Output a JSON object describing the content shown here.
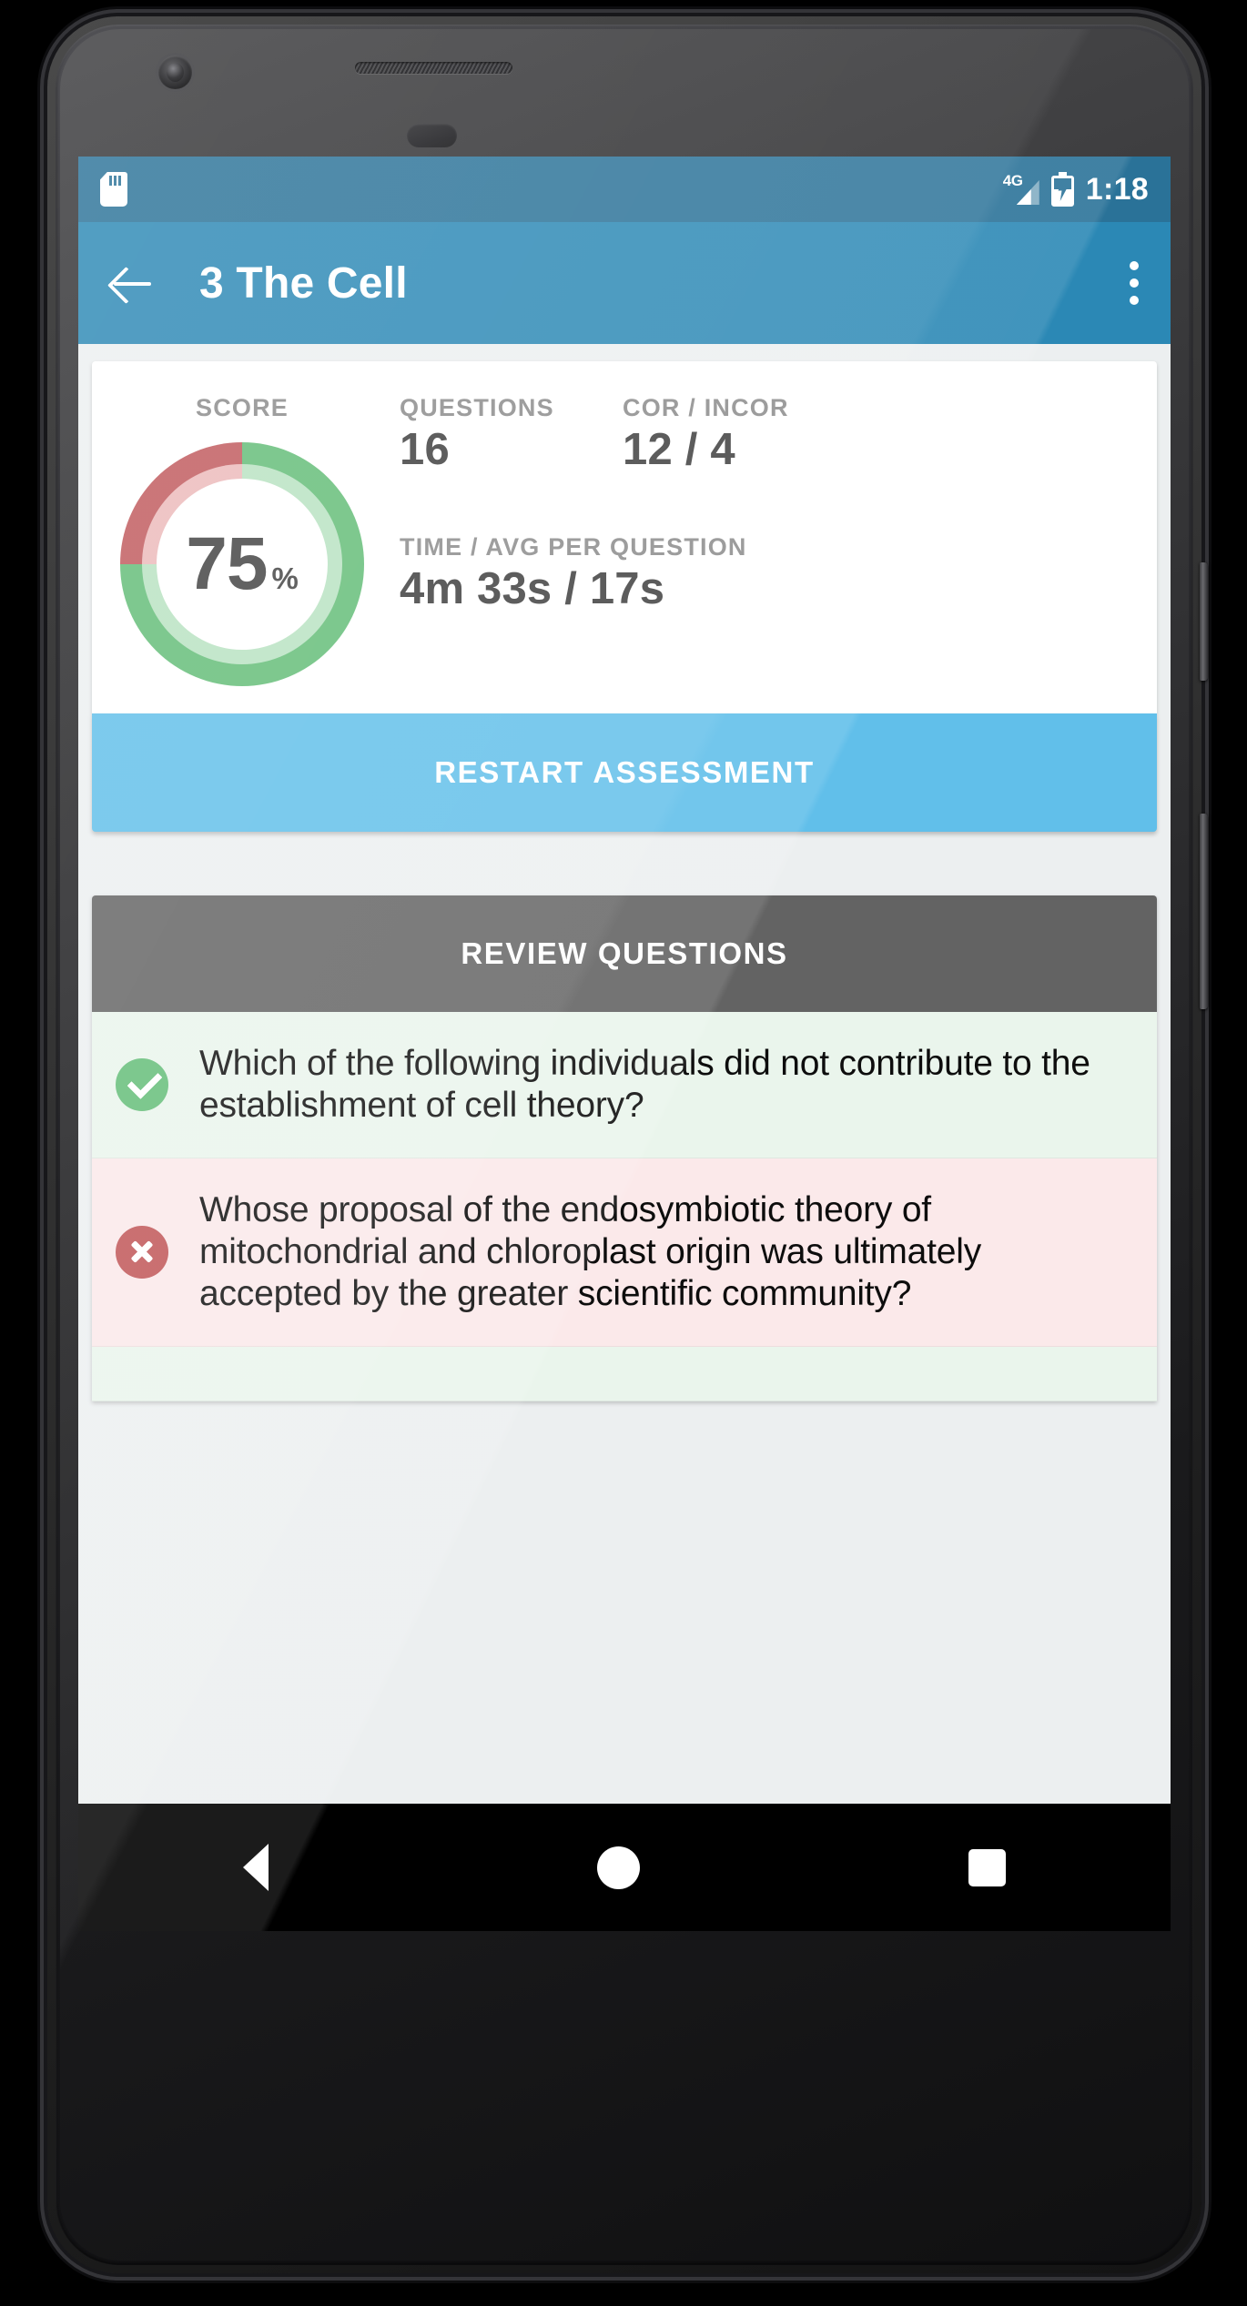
{
  "status_bar": {
    "sd_card_icon": "sd-card-icon",
    "network_label": "4G",
    "signal_icon": "signal-bars-icon",
    "battery_icon": "battery-charging-icon",
    "clock": "1:18"
  },
  "app_bar": {
    "back_icon": "back-arrow-icon",
    "title": "3 The Cell",
    "overflow_icon": "overflow-menu-icon"
  },
  "score_card": {
    "score_label": "SCORE",
    "score_value": "75",
    "score_percent_sign": "%",
    "questions_label": "QUESTIONS",
    "questions_value": "16",
    "cor_incor_label": "COR / INCOR",
    "cor_incor_value": "12 / 4",
    "time_label": "TIME / AVG PER QUESTION",
    "time_value": "4m 33s / 17s"
  },
  "chart_data": {
    "type": "pie",
    "title": "SCORE",
    "categories": [
      "Correct",
      "Incorrect"
    ],
    "values": [
      75,
      25
    ],
    "colors": [
      "#63bd77",
      "#c0595c"
    ],
    "inner_colors": [
      "#b8e2c1",
      "#ecb9ba"
    ],
    "center_label": "75%",
    "start_angle_deg": 0,
    "donut": true
  },
  "buttons": {
    "restart_assessment": "RESTART ASSESSMENT",
    "review_questions": "REVIEW QUESTIONS"
  },
  "questions": [
    {
      "status": "correct",
      "status_icon": "check-circle-icon",
      "text": "Which of the following individuals did not contribute to the establishment of cell theory?"
    },
    {
      "status": "incorrect",
      "status_icon": "x-circle-icon",
      "text": "Whose proposal of the endosymbiotic theory of mitochondrial and chloroplast origin was ultimately accepted by the greater scientific community?"
    },
    {
      "status": "correct",
      "status_icon": "check-circle-icon",
      "text": ""
    }
  ],
  "nav_bar": {
    "back": "nav-back-button",
    "home": "nav-home-button",
    "recents": "nav-recents-button"
  },
  "colors": {
    "status_bar": "#2a7298",
    "app_bar": "#2b88b5",
    "restart_button": "#61bfea",
    "review_header": "#636363",
    "correct_row": "#eaf5ec",
    "incorrect_row": "#fbe9ea",
    "correct_green": "#63bd77",
    "incorrect_red": "#bf5355"
  }
}
